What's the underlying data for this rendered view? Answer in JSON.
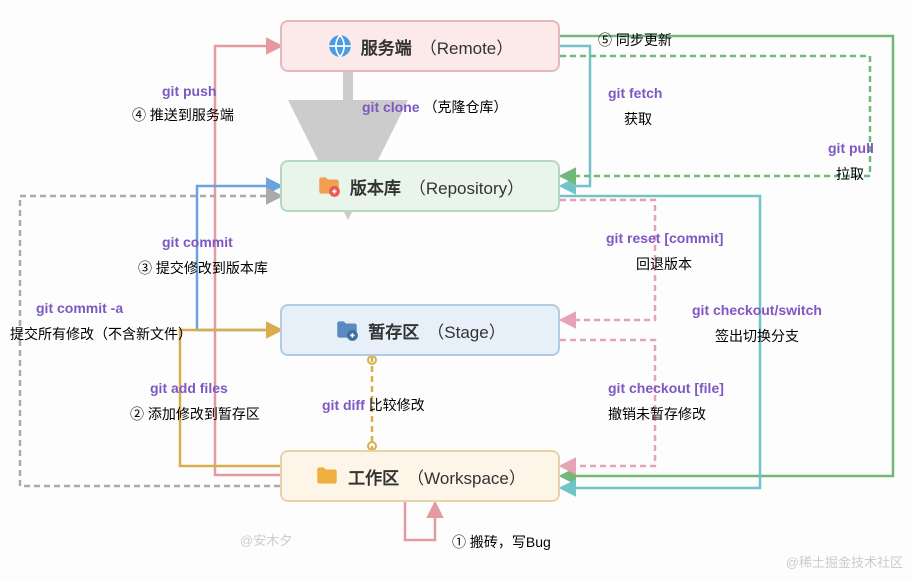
{
  "boxes": {
    "remote": {
      "zh": "服务端",
      "en": "（Remote）"
    },
    "repo": {
      "zh": "版本库",
      "en": "（Repository）"
    },
    "stage": {
      "zh": "暂存区",
      "en": "（Stage）"
    },
    "work": {
      "zh": "工作区",
      "en": "（Workspace）"
    }
  },
  "arrows": {
    "push": {
      "cmd": "git push",
      "desc": "④ 推送到服务端"
    },
    "clone": {
      "cmd": "git clone",
      "desc": "（克隆仓库）"
    },
    "fetch": {
      "cmd": "git fetch",
      "desc": "获取"
    },
    "sync": {
      "desc": "⑤ 同步更新"
    },
    "pull": {
      "cmd": "git pull",
      "desc": "拉取"
    },
    "commit": {
      "cmd": "git commit",
      "desc": "③ 提交修改到版本库"
    },
    "commit_a": {
      "cmd": "git commit -a",
      "desc": "提交所有修改（不含新文件）"
    },
    "reset": {
      "cmd": "git reset [commit]",
      "desc": "回退版本"
    },
    "checkout_switch": {
      "cmd": "git checkout/switch",
      "desc": "签出切换分支"
    },
    "add": {
      "cmd": "git add files",
      "desc": "② 添加修改到暂存区"
    },
    "checkout_file": {
      "cmd": "git checkout [file]",
      "desc": "撤销未暂存修改"
    },
    "diff": {
      "cmd": "git diff",
      "desc": "比较修改"
    },
    "code": {
      "desc": "① 搬砖，写Bug"
    }
  },
  "watermarks": {
    "left": "@安木夕",
    "right": "@稀土掘金技术社区"
  }
}
